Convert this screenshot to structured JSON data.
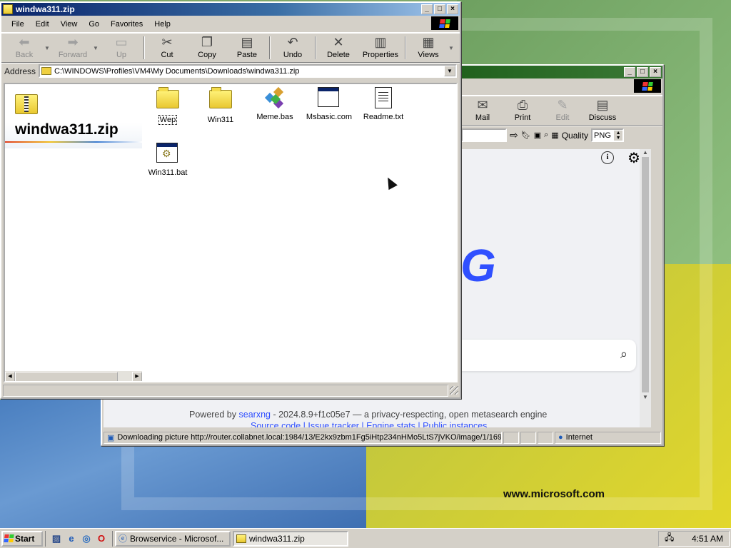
{
  "desktop": {
    "url_text": "www.microsoft.com"
  },
  "explorer": {
    "title": "windwa311.zip",
    "menu": [
      "File",
      "Edit",
      "View",
      "Go",
      "Favorites",
      "Help"
    ],
    "toolbar": {
      "back": "Back",
      "forward": "Forward",
      "up": "Up",
      "cut": "Cut",
      "copy": "Copy",
      "paste": "Paste",
      "undo": "Undo",
      "delete": "Delete",
      "properties": "Properties",
      "views": "Views"
    },
    "address_label": "Address",
    "address_value": "C:\\WINDOWS\\Profiles\\VM4\\My Documents\\Downloads\\windwa311.zip",
    "panel_title": "windwa311.zip",
    "files": [
      {
        "name": "Wep",
        "icon": "folder-icon"
      },
      {
        "name": "Win311",
        "icon": "folder-icon"
      },
      {
        "name": "Meme.bas",
        "icon": "basic-file-icon"
      },
      {
        "name": "Msbasic.com",
        "icon": "application-icon"
      },
      {
        "name": "Readme.txt",
        "icon": "text-document-icon"
      },
      {
        "name": "Win311.bat",
        "icon": "batch-file-icon"
      }
    ]
  },
  "browser": {
    "toolbar": {
      "mail": "Mail",
      "print": "Print",
      "edit": "Edit",
      "discuss": "Discuss"
    },
    "quality_label": "Quality",
    "quality_value": "PNG",
    "logo_fragment": "G",
    "powered_by": "Powered by",
    "searxng_link": "searxng",
    "version_text": "- 2024.8.9+f1c05e7 — a privacy-respecting, open metasearch engine",
    "footer_links": "Source code | Issue tracker | Engine stats | Public instances",
    "status_text": "Downloading picture http://router.collabnet.local:1984/13/E2kx9zbm1Fg5iHtp234nHMo5LtS7jVKO/image/1/169,",
    "zone": "Internet"
  },
  "taskbar": {
    "start": "Start",
    "tasks": [
      {
        "label": "Browservice - Microsof...",
        "active": false
      },
      {
        "label": "windwa311.zip",
        "active": true
      }
    ],
    "clock": "4:51 AM"
  },
  "colors": {
    "active_title": "#0a246a",
    "inactive_title": "#1d5e1a",
    "searxng_blue": "#3050ff"
  }
}
